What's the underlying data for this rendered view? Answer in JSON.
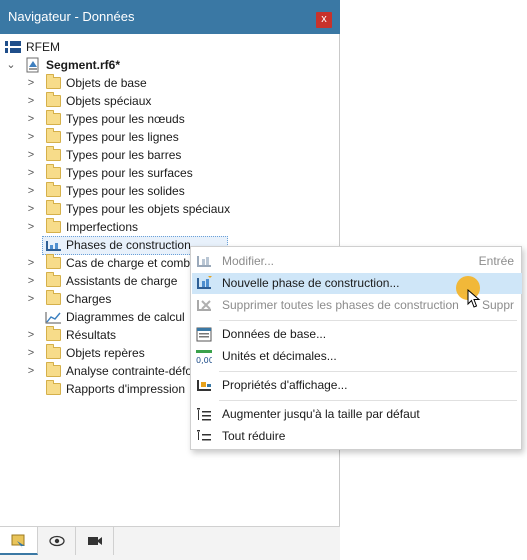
{
  "window": {
    "title": "Navigateur - Données",
    "close_label": "x"
  },
  "tree": {
    "root": "RFEM",
    "file": "Segment.rf6*",
    "items": [
      {
        "label": "Objets de base",
        "chevron": ">"
      },
      {
        "label": "Objets spéciaux",
        "chevron": ">"
      },
      {
        "label": "Types pour les nœuds",
        "chevron": ">"
      },
      {
        "label": "Types pour les lignes",
        "chevron": ">"
      },
      {
        "label": "Types pour les barres",
        "chevron": ">"
      },
      {
        "label": "Types pour les surfaces",
        "chevron": ">"
      },
      {
        "label": "Types pour les solides",
        "chevron": ">"
      },
      {
        "label": "Types pour les objets spéciaux",
        "chevron": ">"
      },
      {
        "label": "Imperfections",
        "chevron": ">"
      },
      {
        "label": "Phases de construction",
        "chevron": ""
      },
      {
        "label": "Cas de charge et combi",
        "chevron": ">"
      },
      {
        "label": "Assistants de charge",
        "chevron": ">"
      },
      {
        "label": "Charges",
        "chevron": ">"
      },
      {
        "label": "Diagrammes de calcul",
        "chevron": ""
      },
      {
        "label": "Résultats",
        "chevron": ">"
      },
      {
        "label": "Objets repères",
        "chevron": ">"
      },
      {
        "label": "Analyse contrainte-défo",
        "chevron": ">"
      },
      {
        "label": "Rapports d'impression",
        "chevron": ""
      }
    ]
  },
  "context_menu": {
    "modify": {
      "label": "Modifier...",
      "shortcut": "Entrée"
    },
    "new_phase": {
      "label": "Nouvelle phase de construction..."
    },
    "delete_all": {
      "label": "Supprimer toutes les phases de construction",
      "shortcut": "Suppr"
    },
    "base_data": {
      "label": "Données de base..."
    },
    "units": {
      "label": "Unités et décimales..."
    },
    "display": {
      "label": "Propriétés d'affichage..."
    },
    "expand": {
      "label": "Augmenter jusqu'à la taille par défaut"
    },
    "collapse": {
      "label": "Tout réduire"
    }
  },
  "colors": {
    "titlebar": "#3a78a4",
    "highlight": "#cfe6f8",
    "close": "#c8322b",
    "cursor_dot": "#f4b324"
  }
}
